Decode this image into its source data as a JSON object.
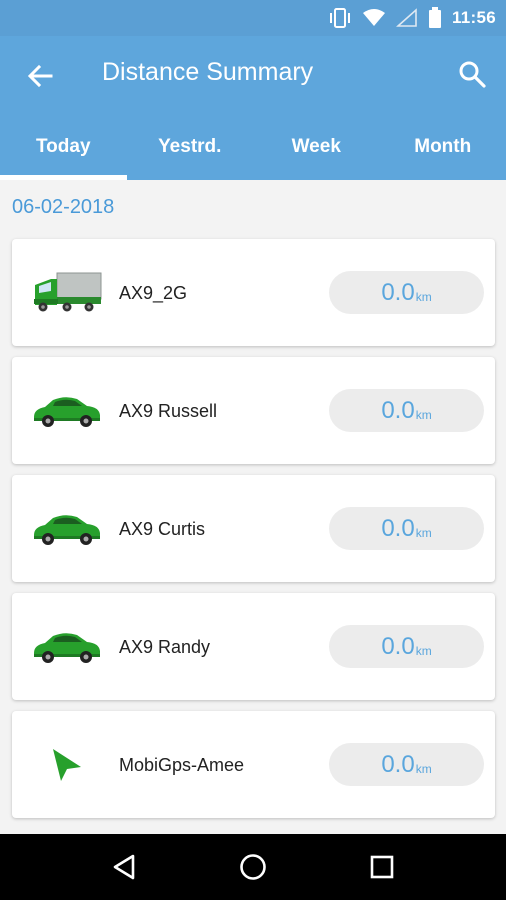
{
  "status_bar": {
    "time": "11:56",
    "icons": [
      "vibrate-icon",
      "wifi-icon",
      "signal-icon",
      "battery-icon"
    ]
  },
  "app_bar": {
    "title": "Distance Summary",
    "back_icon": "arrow-left-icon",
    "search_icon": "search-icon"
  },
  "tabs": [
    {
      "label": "Today",
      "active": true
    },
    {
      "label": "Yestrd.",
      "active": false
    },
    {
      "label": "Week",
      "active": false
    },
    {
      "label": "Month",
      "active": false
    }
  ],
  "date": "06-02-2018",
  "vehicles": [
    {
      "name": "AX9_2G",
      "icon": "truck-icon",
      "distance": "0.0",
      "unit": "km"
    },
    {
      "name": "AX9 Russell",
      "icon": "car-icon",
      "distance": "0.0",
      "unit": "km"
    },
    {
      "name": "AX9 Curtis",
      "icon": "car-icon",
      "distance": "0.0",
      "unit": "km"
    },
    {
      "name": "AX9 Randy",
      "icon": "car-icon",
      "distance": "0.0",
      "unit": "km"
    },
    {
      "name": "MobiGps-Amee",
      "icon": "navigation-arrow-icon",
      "distance": "0.0",
      "unit": "km"
    }
  ],
  "colors": {
    "app_bar": "#5ea6dc",
    "status_bar": "#5b9fd4",
    "accent": "#4a9ad8",
    "vehicle_green": "#27a02c"
  },
  "nav_bar": {
    "back": "nav-back-icon",
    "home": "nav-home-icon",
    "recents": "nav-recents-icon"
  }
}
